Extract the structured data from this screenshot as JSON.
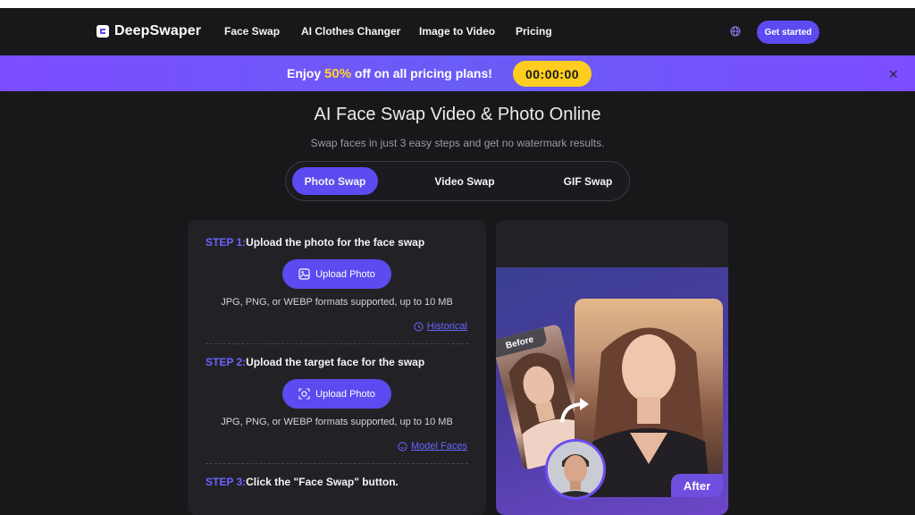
{
  "nav": {
    "logo_text": "DeepSwaper",
    "links": [
      "Face Swap",
      "AI Clothes Changer",
      "Image to Video",
      "Pricing"
    ],
    "cta": "Get started"
  },
  "promo": {
    "prefix": "Enjoy ",
    "highlight": "50%",
    "suffix": " off on all pricing plans!",
    "timer": "00:00:00"
  },
  "hero": {
    "title": "AI Face Swap Video & Photo Online",
    "subtitle": "Swap faces in just 3 easy steps and get no watermark results."
  },
  "tabs": [
    {
      "label": "Photo Swap",
      "active": true
    },
    {
      "label": "Video Swap",
      "active": false
    },
    {
      "label": "GIF Swap",
      "active": false
    }
  ],
  "steps": [
    {
      "num": "STEP 1:",
      "title": "Upload the photo for the face swap",
      "button": "Upload Photo",
      "formats": "JPG, PNG, or WEBP formats supported, up to 10 MB",
      "link": "Historical"
    },
    {
      "num": "STEP 2:",
      "title": "Upload the target face for the swap",
      "button": "Upload Photo",
      "formats": "JPG, PNG, or WEBP formats supported, up to 10 MB",
      "link": "Model Faces"
    },
    {
      "num": "STEP 3:",
      "title": "Click the \"Face Swap\" button."
    }
  ],
  "preview": {
    "before": "Before",
    "after": "After"
  },
  "colors": {
    "accent": "#5b4bf0",
    "timer": "#ffcd1f",
    "highlight": "#ffd230"
  }
}
